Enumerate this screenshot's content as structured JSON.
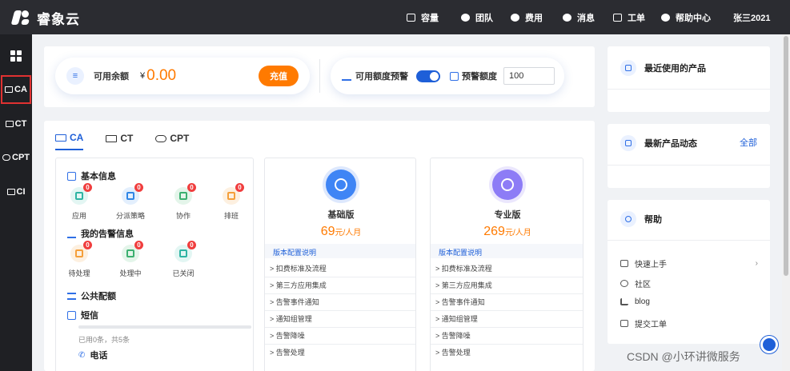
{
  "brand": {
    "name": "睿象云"
  },
  "topnav": [
    {
      "label": "容量",
      "icon": "storage-icon"
    },
    {
      "label": "团队",
      "icon": "team-icon"
    },
    {
      "label": "费用",
      "icon": "cost-icon"
    },
    {
      "label": "消息",
      "icon": "bell-icon"
    },
    {
      "label": "工单",
      "icon": "ticket-icon"
    },
    {
      "label": "帮助中心",
      "icon": "help-icon"
    },
    {
      "label": "张三2021",
      "icon": ""
    }
  ],
  "sidebar": {
    "items": [
      {
        "label": ""
      },
      {
        "label": "CA"
      },
      {
        "label": "CT"
      },
      {
        "label": "CPT"
      },
      {
        "label": "CI"
      }
    ],
    "active_index": 1
  },
  "balance": {
    "label": "可用余额",
    "currency": "¥",
    "amount": "0.00",
    "recharge_label": "充值"
  },
  "alert_settings": {
    "warning_label": "可用额度预警",
    "warning_enabled": true,
    "threshold_label": "预警额度",
    "threshold_value": "100"
  },
  "tabs": [
    {
      "label": "CA"
    },
    {
      "label": "CT"
    },
    {
      "label": "CPT"
    }
  ],
  "basic_info": {
    "title": "基本信息",
    "apps": [
      {
        "label": "应用",
        "badge": "0",
        "color": "#2fb4a3",
        "bg": "#e3f6f3"
      },
      {
        "label": "分派策略",
        "badge": "0",
        "color": "#2f86e6",
        "bg": "#e3effd"
      },
      {
        "label": "协作",
        "badge": "0",
        "color": "#3bb070",
        "bg": "#e4f5ea"
      },
      {
        "label": "排班",
        "badge": "0",
        "color": "#f59f3a",
        "bg": "#fdf0e0"
      }
    ]
  },
  "alert_info": {
    "title": "我的告警信息",
    "apps": [
      {
        "label": "待处理",
        "badge": "0",
        "color": "#f59f3a",
        "bg": "#fdf0e0"
      },
      {
        "label": "处理中",
        "badge": "0",
        "color": "#3bb070",
        "bg": "#e4f5ea"
      },
      {
        "label": "已关闭",
        "badge": "0",
        "color": "#2fb4a3",
        "bg": "#e3f6f3"
      }
    ]
  },
  "public_config": {
    "title": "公共配额"
  },
  "sms": {
    "title": "短信",
    "usage": "已用0条，共5条",
    "used_fraction": 0
  },
  "phone": {
    "title": "电话"
  },
  "plans": [
    {
      "name": "基础版",
      "price": "69",
      "unit": "元/人月",
      "icon_color": "#3f85f5",
      "config_label": "版本配置说明",
      "features": [
        "扣费标准及流程",
        "第三方应用集成",
        "告警事件通知",
        "通知组管理",
        "告警降噪",
        "告警处理"
      ]
    },
    {
      "name": "专业版",
      "price": "269",
      "unit": "元/人月",
      "icon_color": "#8d7cf6",
      "config_label": "版本配置说明",
      "features": [
        "扣费标准及流程",
        "第三方应用集成",
        "告警事件通知",
        "通知组管理",
        "告警降噪",
        "告警处理"
      ]
    }
  ],
  "recent_products": {
    "title": "最近使用的产品"
  },
  "news": {
    "title": "最新产品动态",
    "all_label": "全部"
  },
  "help": {
    "title": "帮助",
    "items": [
      {
        "label": "快速上手",
        "icon": "rocket-icon"
      },
      {
        "label": "社区",
        "icon": "community-icon"
      },
      {
        "label": "blog",
        "icon": "blog-icon"
      },
      {
        "label": "提交工单",
        "icon": "submit-ticket-icon"
      }
    ]
  },
  "watermark": "CSDN @小环讲微服务"
}
